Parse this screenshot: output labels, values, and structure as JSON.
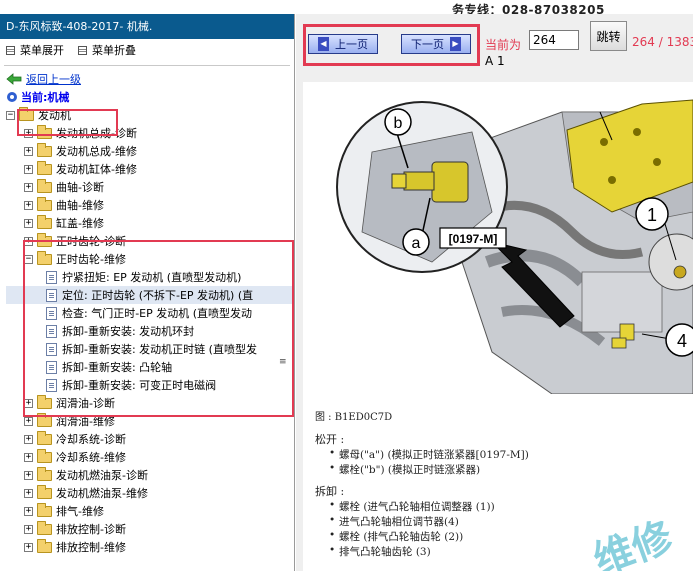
{
  "banner": {
    "hotline": "务专线：028-87038205"
  },
  "left": {
    "title": "D-东风标致-408-2017- 机械.",
    "menu": {
      "expand": "菜单展开",
      "collapse": "菜单折叠"
    },
    "back": "返回上一级",
    "current": "当前:机械",
    "tree": [
      {
        "label": "发动机",
        "type": "folder",
        "level": 0,
        "expander": "−"
      },
      {
        "label": "发动机总成-诊断",
        "type": "folder",
        "level": 1,
        "expander": "+"
      },
      {
        "label": "发动机总成-维修",
        "type": "folder",
        "level": 1,
        "expander": "+"
      },
      {
        "label": "发动机缸体-维修",
        "type": "folder",
        "level": 1,
        "expander": "+"
      },
      {
        "label": "曲轴-诊断",
        "type": "folder",
        "level": 1,
        "expander": "+"
      },
      {
        "label": "曲轴-维修",
        "type": "folder",
        "level": 1,
        "expander": "+"
      },
      {
        "label": "缸盖-维修",
        "type": "folder",
        "level": 1,
        "expander": "+"
      },
      {
        "label": "正时齿轮-诊断",
        "type": "folder",
        "level": 1,
        "expander": "+"
      },
      {
        "label": "正时齿轮-维修",
        "type": "folder",
        "level": 1,
        "expander": "−"
      },
      {
        "label": "拧紧扭矩: EP 发动机 (直喷型发动机)",
        "type": "doc",
        "level": 2
      },
      {
        "label": "定位: 正时齿轮 (不拆下-EP 发动机) (直",
        "type": "doc",
        "level": 2,
        "selected": true
      },
      {
        "label": "检查: 气门正时-EP 发动机 (直喷型发动",
        "type": "doc",
        "level": 2
      },
      {
        "label": "拆卸-重新安装: 发动机环封",
        "type": "doc",
        "level": 2
      },
      {
        "label": "拆卸-重新安装: 发动机正时链 (直喷型发",
        "type": "doc",
        "level": 2
      },
      {
        "label": "拆卸-重新安装: 凸轮轴",
        "type": "doc",
        "level": 2
      },
      {
        "label": "拆卸-重新安装: 可变正时电磁阀",
        "type": "doc",
        "level": 2
      },
      {
        "label": "润滑油-诊断",
        "type": "folder",
        "level": 1,
        "expander": "+"
      },
      {
        "label": "润滑油-维修",
        "type": "folder",
        "level": 1,
        "expander": "+"
      },
      {
        "label": "冷却系统-诊断",
        "type": "folder",
        "level": 1,
        "expander": "+"
      },
      {
        "label": "冷却系统-维修",
        "type": "folder",
        "level": 1,
        "expander": "+"
      },
      {
        "label": "发动机燃油泵-诊断",
        "type": "folder",
        "level": 1,
        "expander": "+"
      },
      {
        "label": "发动机燃油泵-维修",
        "type": "folder",
        "level": 1,
        "expander": "+"
      },
      {
        "label": "排气-维修",
        "type": "folder",
        "level": 1,
        "expander": "+"
      },
      {
        "label": "排放控制-诊断",
        "type": "folder",
        "level": 1,
        "expander": "+"
      },
      {
        "label": "排放控制-维修",
        "type": "folder",
        "level": 1,
        "expander": "+"
      }
    ]
  },
  "nav": {
    "prev": "上一页",
    "next": "下一页",
    "current_label": "当前为",
    "page_value": "264",
    "jump": "跳转",
    "page_count": "264 / 1383",
    "sub": "A 1"
  },
  "figure": {
    "callout_a": "a",
    "callout_b": "b",
    "tool_code": "[0197-M]",
    "label_1": "1",
    "label_4": "4",
    "caption": "图 :  B1ED0C7D"
  },
  "loosen": {
    "heading": "松开 :",
    "items": [
      "螺母(\"a\") (模拟正时链涨紧器[0197-M])",
      "螺栓(\"b\") (模拟正时链涨紧器)"
    ]
  },
  "remove": {
    "heading": "拆卸 :",
    "items": [
      "螺栓 (进气凸轮轴相位调整器 (1))",
      "进气凸轮轴相位调节器(4)",
      "螺栓 (排气凸轮轴齿轮 (2))",
      "排气凸轮轴齿轮 (3)"
    ]
  },
  "watermark": "维修"
}
